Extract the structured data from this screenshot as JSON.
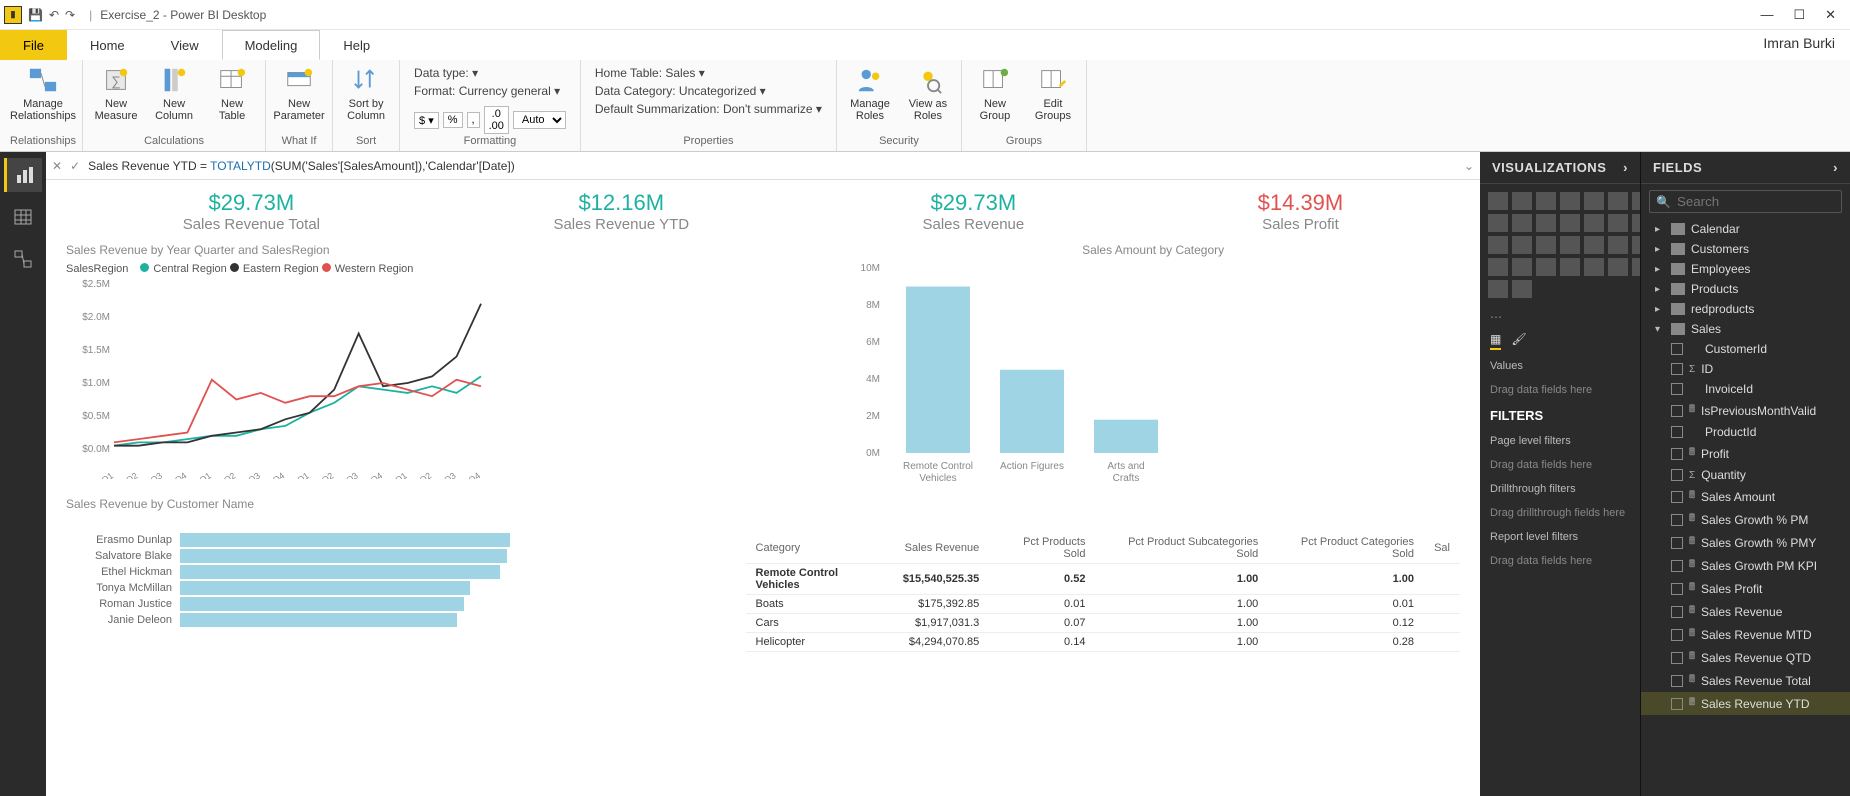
{
  "titlebar": {
    "title": "Exercise_2 - Power BI Desktop"
  },
  "user": "Imran Burki",
  "menu": {
    "file": "File",
    "home": "Home",
    "view": "View",
    "modeling": "Modeling",
    "help": "Help"
  },
  "ribbon": {
    "relationships": {
      "label": "Relationships",
      "manage": "Manage\nRelationships"
    },
    "calculations": {
      "label": "Calculations",
      "newMeasure": "New\nMeasure",
      "newColumn": "New\nColumn",
      "newTable": "New\nTable"
    },
    "whatif": {
      "label": "What If",
      "newParameter": "New\nParameter"
    },
    "sort": {
      "label": "Sort",
      "sortBy": "Sort by\nColumn"
    },
    "formatting": {
      "label": "Formatting",
      "dataType": "Data type:",
      "format": "Format: Currency general",
      "auto": "Auto"
    },
    "properties": {
      "label": "Properties",
      "homeTable": "Home Table: Sales",
      "dataCategory": "Data Category: Uncategorized",
      "defaultSumm": "Default Summarization: Don't summarize"
    },
    "security": {
      "label": "Security",
      "manageRoles": "Manage\nRoles",
      "viewAs": "View as\nRoles"
    },
    "groups": {
      "label": "Groups",
      "newGroup": "New\nGroup",
      "editGroups": "Edit\nGroups"
    }
  },
  "formula": {
    "prefix": "Sales Revenue YTD = ",
    "fn": "TOTALYTD",
    "args": "(SUM('Sales'[SalesAmount]),'Calendar'[Date])"
  },
  "cards": [
    {
      "value": "$29.73M",
      "label": "Sales Revenue Total",
      "cls": "teal"
    },
    {
      "value": "$12.16M",
      "label": "Sales Revenue YTD",
      "cls": "teal"
    },
    {
      "value": "$29.73M",
      "label": "Sales Revenue",
      "cls": "teal"
    },
    {
      "value": "$14.39M",
      "label": "Sales Profit",
      "cls": "red"
    }
  ],
  "lineChart": {
    "title": "Sales Revenue by Year Quarter and SalesRegion",
    "legendLabel": "SalesRegion",
    "series": [
      {
        "name": "Central Region",
        "color": "#1db2a0"
      },
      {
        "name": "Eastern Region",
        "color": "#333333"
      },
      {
        "name": "Western Region",
        "color": "#e0524f"
      }
    ],
    "yTicks": [
      "$2.5M",
      "$2.0M",
      "$1.5M",
      "$1.0M",
      "$0.5M",
      "$0.0M"
    ],
    "xTicks": [
      "2012-Q1",
      "2012-Q2",
      "2012-Q3",
      "2012-Q4",
      "2013-Q1",
      "2013-Q2",
      "2013-Q3",
      "2013-Q4",
      "2014-Q1",
      "2014-Q2",
      "2014-Q3",
      "2014-Q4",
      "2015-Q1",
      "2015-Q2",
      "2015-Q3",
      "2015-Q4"
    ]
  },
  "barChart": {
    "title": "Sales Amount by Category",
    "yTicks": [
      "10M",
      "8M",
      "6M",
      "4M",
      "2M",
      "0M"
    ],
    "bars": [
      {
        "label": "Remote Control Vehicles",
        "value": 9.0
      },
      {
        "label": "Action Figures",
        "value": 4.5
      },
      {
        "label": "Arts and Crafts",
        "value": 1.8
      }
    ]
  },
  "hbarChart": {
    "title": "Sales Revenue by Customer Name",
    "rows": [
      {
        "label": "Erasmo Dunlap",
        "v": 100
      },
      {
        "label": "Salvatore Blake",
        "v": 99
      },
      {
        "label": "Ethel Hickman",
        "v": 97
      },
      {
        "label": "Tonya McMillan",
        "v": 88
      },
      {
        "label": "Roman Justice",
        "v": 86
      },
      {
        "label": "Janie Deleon",
        "v": 84
      }
    ]
  },
  "table": {
    "columns": [
      "Category",
      "Sales Revenue",
      "Pct Products Sold",
      "Pct Product Subcategories Sold",
      "Pct Product Categories Sold",
      "Sal"
    ],
    "rows": [
      [
        "Remote Control Vehicles",
        "$15,540,525.35",
        "0.52",
        "1.00",
        "1.00",
        ""
      ],
      [
        "Boats",
        "$175,392.85",
        "0.01",
        "1.00",
        "0.01",
        ""
      ],
      [
        "Cars",
        "$1,917,031.3",
        "0.07",
        "1.00",
        "0.12",
        ""
      ],
      [
        "Helicopter",
        "$4,294,070.85",
        "0.14",
        "1.00",
        "0.28",
        ""
      ]
    ]
  },
  "viz": {
    "head": "VISUALIZATIONS",
    "values": "Values",
    "dragFields": "Drag data fields here",
    "filtersHead": "FILTERS",
    "pageFilters": "Page level filters",
    "drill": "Drillthrough filters",
    "dragDrill": "Drag drillthrough fields here",
    "report": "Report level filters"
  },
  "fields": {
    "head": "FIELDS",
    "searchPlaceholder": "Search",
    "tables": [
      "Calendar",
      "Customers",
      "Employees",
      "Products",
      "redproducts"
    ],
    "salesLabel": "Sales",
    "salesFields": [
      {
        "n": "CustomerId",
        "calc": false
      },
      {
        "n": "ID",
        "calc": false,
        "sigma": true
      },
      {
        "n": "InvoiceId",
        "calc": false
      },
      {
        "n": "IsPreviousMonthValid",
        "calc": true
      },
      {
        "n": "ProductId",
        "calc": false
      },
      {
        "n": "Profit",
        "calc": true
      },
      {
        "n": "Quantity",
        "calc": false,
        "sigma": true
      },
      {
        "n": "Sales Amount",
        "calc": true
      },
      {
        "n": "Sales Growth % PM",
        "calc": true
      },
      {
        "n": "Sales Growth % PMY",
        "calc": true
      },
      {
        "n": "Sales Growth PM KPI",
        "calc": true
      },
      {
        "n": "Sales Profit",
        "calc": true
      },
      {
        "n": "Sales Revenue",
        "calc": true
      },
      {
        "n": "Sales Revenue MTD",
        "calc": true
      },
      {
        "n": "Sales Revenue QTD",
        "calc": true
      },
      {
        "n": "Sales Revenue Total",
        "calc": true
      },
      {
        "n": "Sales Revenue YTD",
        "calc": true,
        "sel": true
      }
    ]
  },
  "chart_data": [
    {
      "type": "line",
      "title": "Sales Revenue by Year Quarter and SalesRegion",
      "xlabel": "",
      "ylabel": "",
      "ylim": [
        0,
        2.5
      ],
      "categories": [
        "2012-Q1",
        "2012-Q2",
        "2012-Q3",
        "2012-Q4",
        "2013-Q1",
        "2013-Q2",
        "2013-Q3",
        "2013-Q4",
        "2014-Q1",
        "2014-Q2",
        "2014-Q3",
        "2014-Q4",
        "2015-Q1",
        "2015-Q2",
        "2015-Q3",
        "2015-Q4"
      ],
      "series": [
        {
          "name": "Central Region",
          "values": [
            0.05,
            0.1,
            0.1,
            0.15,
            0.2,
            0.2,
            0.3,
            0.35,
            0.55,
            0.7,
            0.95,
            0.9,
            0.85,
            0.95,
            0.85,
            1.1
          ]
        },
        {
          "name": "Eastern Region",
          "values": [
            0.05,
            0.05,
            0.1,
            0.1,
            0.2,
            0.25,
            0.3,
            0.45,
            0.55,
            0.9,
            1.75,
            0.95,
            1.0,
            1.1,
            1.4,
            2.2
          ]
        },
        {
          "name": "Western Region",
          "values": [
            0.1,
            0.15,
            0.2,
            0.25,
            1.05,
            0.75,
            0.85,
            0.7,
            0.8,
            0.8,
            0.95,
            1.0,
            0.9,
            0.8,
            1.05,
            0.95
          ]
        }
      ]
    },
    {
      "type": "bar",
      "title": "Sales Amount by Category",
      "xlabel": "",
      "ylabel": "",
      "ylim": [
        0,
        10
      ],
      "categories": [
        "Remote Control Vehicles",
        "Action Figures",
        "Arts and Crafts"
      ],
      "values": [
        9.0,
        4.5,
        1.8
      ]
    },
    {
      "type": "bar",
      "title": "Sales Revenue by Customer Name",
      "orientation": "horizontal",
      "categories": [
        "Erasmo Dunlap",
        "Salvatore Blake",
        "Ethel Hickman",
        "Tonya McMillan",
        "Roman Justice",
        "Janie Deleon"
      ],
      "values": [
        100,
        99,
        97,
        88,
        86,
        84
      ]
    },
    {
      "type": "table",
      "columns": [
        "Category",
        "Sales Revenue",
        "Pct Products Sold",
        "Pct Product Subcategories Sold",
        "Pct Product Categories Sold"
      ],
      "rows": [
        [
          "Remote Control Vehicles",
          15540525.35,
          0.52,
          1.0,
          1.0
        ],
        [
          "Boats",
          175392.85,
          0.01,
          1.0,
          0.01
        ],
        [
          "Cars",
          1917031.3,
          0.07,
          1.0,
          0.12
        ],
        [
          "Helicopter",
          4294070.85,
          0.14,
          1.0,
          0.28
        ]
      ]
    }
  ]
}
